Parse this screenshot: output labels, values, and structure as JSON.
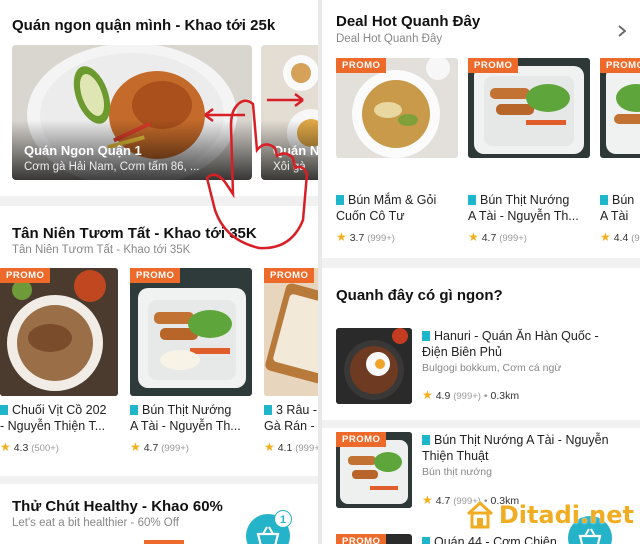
{
  "left": {
    "section1": {
      "title": "Quán ngon quận mình - Khao tới 25k",
      "cover1": {
        "title": "Quán Ngon Quận 1",
        "subtitle": "Cơm gà Hải Nam, Cơm tấm 86, ..."
      },
      "cover2": {
        "title": "Quán N",
        "subtitle": "Xôi gà"
      }
    },
    "section2": {
      "title": "Tân Niên Tươm Tất - Khao tới 35K",
      "subtitle": "Tân Niên Tươm Tất - Khao tới 35K",
      "items": [
        {
          "badge": "PROMO",
          "name_line1": "Chuối Vịt Cồ 202",
          "name_line2": "- Nguyễn Thiện T...",
          "rating": "4.3",
          "count": "(500+)"
        },
        {
          "badge": "PROMO",
          "name_line1": "Bún Thịt Nướng",
          "name_line2": "A Tài - Nguyễn Th...",
          "rating": "4.7",
          "count": "(999+)"
        },
        {
          "badge": "PROMO",
          "name_line1": "3 Râu -",
          "name_line2": "Gà Rán -",
          "rating": "4.1",
          "count": "(999+)"
        }
      ]
    },
    "section3": {
      "title": "Thử Chút Healthy - Khao 60%",
      "subtitle": "Let's eat a bit healthier - 60% Off"
    },
    "cart_count": "1"
  },
  "right": {
    "section1": {
      "title": "Deal Hot Quanh Đây",
      "subtitle": "Deal Hot Quanh Đây",
      "items": [
        {
          "badge": "PROMO",
          "name_line1": "Bún Mắm & Gỏi",
          "name_line2": "Cuốn Cô Tư",
          "rating": "3.7",
          "count": "(999+)"
        },
        {
          "badge": "PROMO",
          "name_line1": "Bún Thịt Nướng",
          "name_line2": "A Tài - Nguyễn Th...",
          "rating": "4.7",
          "count": "(999+)"
        },
        {
          "badge": "PROMO",
          "name_line1": "Bún",
          "name_line2": "A Tài",
          "rating": "4.4",
          "count": "(9"
        }
      ]
    },
    "section2": {
      "title": "Quanh đây có gì ngon?",
      "rows": [
        {
          "name_line1": "Hanuri - Quán Ăn Hàn Quốc -",
          "name_line2": "Điện Biên Phủ",
          "desc": "Bulgogi bokkum, Cơm cá ngừ",
          "rating": "4.9",
          "count": "(999+)",
          "distance": "0.3km"
        },
        {
          "badge": "PROMO",
          "name_line1": "Bún Thịt Nướng A Tài - Nguyễn",
          "name_line2": "Thiện Thuật",
          "desc": "Bún thịt nướng",
          "rating": "4.7",
          "count": "(999+)",
          "distance": "0.3km"
        },
        {
          "badge": "PROMO",
          "name_line1": "Quán 44 - Cơm Chiên"
        }
      ]
    },
    "watermark": "Ditadi.net"
  },
  "icons": {
    "chevron": "chevron-right-icon",
    "cart": "shopping-basket-icon",
    "star": "star-icon",
    "flag": "restaurant-flag-icon",
    "gesture": "swipe-hand-gesture-icon"
  },
  "colors": {
    "promo": "#ee6a2a",
    "accent": "#25b3c9",
    "star": "#f2b01e",
    "watermark": "#f0ad22"
  }
}
